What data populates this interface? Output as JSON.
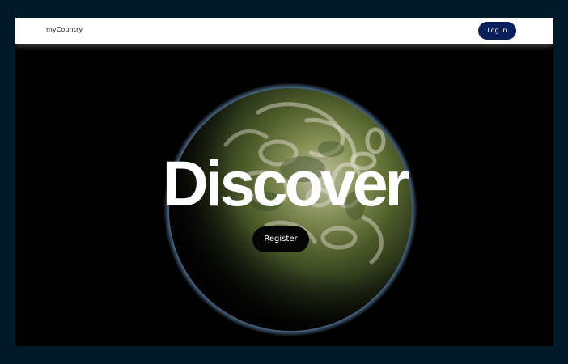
{
  "navbar": {
    "brand": "myCountry",
    "login_label": "Log In"
  },
  "hero": {
    "headline": "Discover",
    "register_label": "Register",
    "image_icon": "planet-earth-image"
  },
  "colors": {
    "page_background": "#011a2a",
    "hero_background": "#000000",
    "login_button": "#0b1f5c",
    "register_button": "#050505",
    "navbar_background": "#ffffff"
  }
}
